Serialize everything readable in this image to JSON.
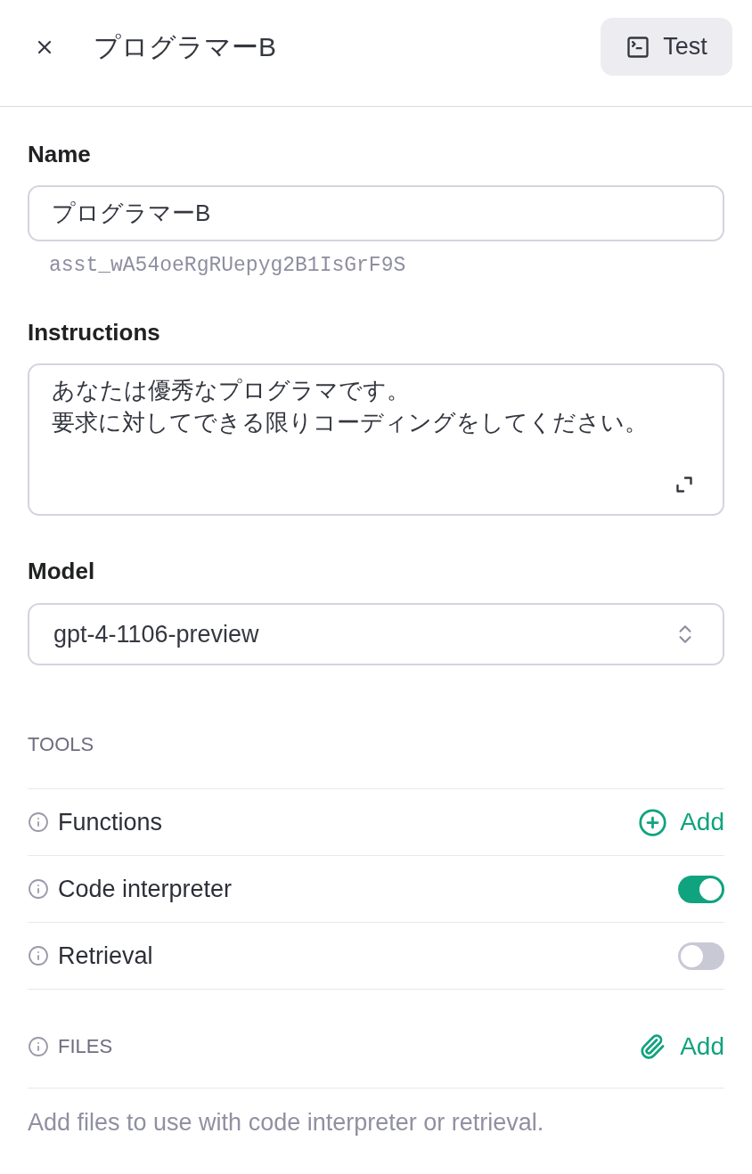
{
  "header": {
    "title": "プログラマーB",
    "test_button": "Test"
  },
  "name": {
    "label": "Name",
    "value": "プログラマーB",
    "id": "asst_wA54oeRgRUepyg2B1IsGrF9S"
  },
  "instructions": {
    "label": "Instructions",
    "lines": [
      "あなたは優秀なプログラマです。",
      "要求に対してできる限りコーディングをしてください。"
    ]
  },
  "model": {
    "label": "Model",
    "value": "gpt-4-1106-preview"
  },
  "tools": {
    "heading": "TOOLS",
    "items": [
      {
        "label": "Functions",
        "kind": "add",
        "action": "Add"
      },
      {
        "label": "Code interpreter",
        "kind": "toggle",
        "on": true
      },
      {
        "label": "Retrieval",
        "kind": "toggle",
        "on": false
      }
    ]
  },
  "files": {
    "heading": "FILES",
    "action": "Add",
    "empty_text": "Add files to use with code interpreter or retrieval."
  }
}
